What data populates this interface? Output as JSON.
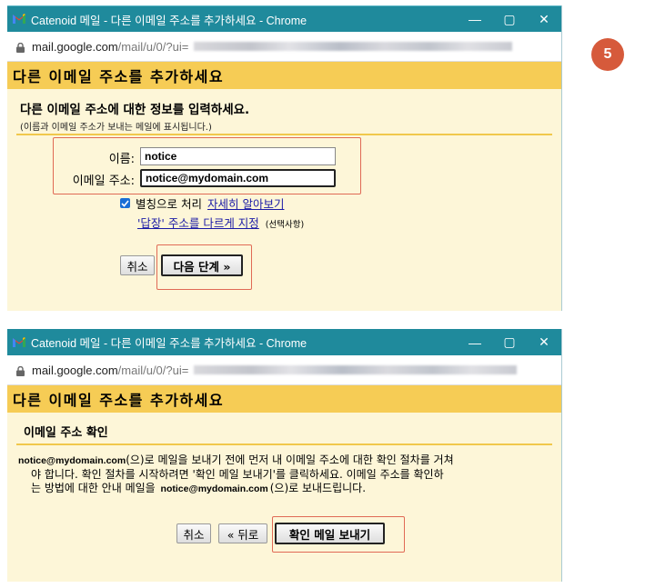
{
  "step_badge": "5",
  "window1": {
    "title": "Catenoid 메일 - 다른 이메일 주소를 추가하세요 - Chrome",
    "controls": {
      "minimize": "—",
      "maximize": "▢",
      "close": "✕"
    },
    "url_host": "mail.google.com",
    "url_path": "/mail/u/0/?ui=",
    "header": "다른 이메일 주소를 추가하세요",
    "section_title": "다른 이메일 주소에 대한 정보를 입력하세요.",
    "section_sub": "(이름과 이메일 주소가 보내는 메일에 표시됩니다.)",
    "name_label": "이름:",
    "name_value": "notice",
    "email_label": "이메일 주소:",
    "email_value": "notice@mydomain.com",
    "alias_text": "별칭으로 처리",
    "learn_more": "자세히 알아보기",
    "reply_to_link": "'답장' 주소를 다르게 지정",
    "optional": "(선택사항)",
    "cancel": "취소",
    "next": "다음 단계 »"
  },
  "window2": {
    "title": "Catenoid 메일 - 다른 이메일 주소를 추가하세요 - Chrome",
    "controls": {
      "minimize": "—",
      "maximize": "▢",
      "close": "✕"
    },
    "url_host": "mail.google.com",
    "url_path": "/mail/u/0/?ui=",
    "header": "다른 이메일 주소를 추가하세요",
    "section_title": "이메일 주소 확인",
    "email": "notice@mydomain.com",
    "body_line1_rest": "(으)로 메일을 보내기 전에 먼저 내 이메일 주소에 대한 확인 절차를 거쳐",
    "body_line2": "야 합니다. 확인 절차를 시작하려면 '확인 메일 보내기'를 클릭하세요. 이메일 주소를 확인하",
    "body_line3_pre": "는 방법에 대한 안내 메일을",
    "body_line3_post": "(으)로 보내드립니다.",
    "cancel": "취소",
    "back": "« 뒤로",
    "send": "확인 메일 보내기"
  }
}
